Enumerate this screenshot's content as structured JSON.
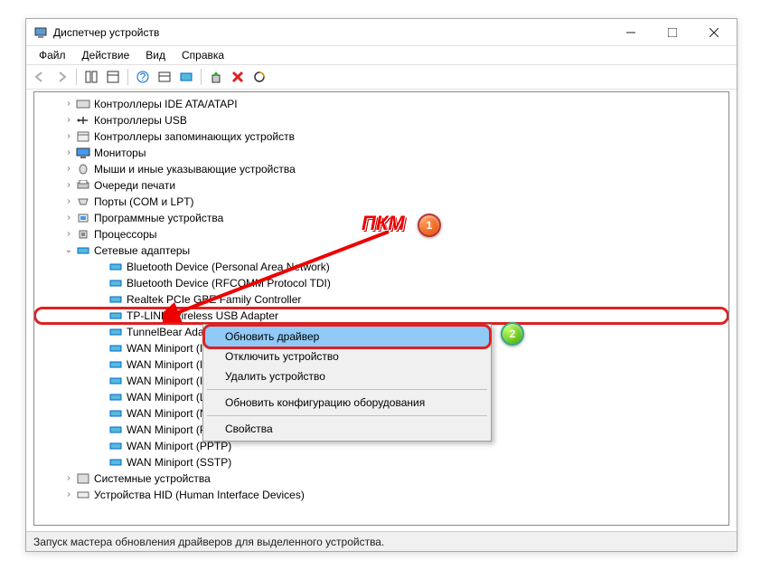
{
  "window": {
    "title": "Диспетчер устройств"
  },
  "menu": {
    "file": "Файл",
    "action": "Действие",
    "view": "Вид",
    "help": "Справка"
  },
  "categories": {
    "ide": "Контроллеры IDE ATA/ATAPI",
    "usb": "Контроллеры USB",
    "storage": "Контроллеры запоминающих устройств",
    "monitors": "Мониторы",
    "pointers": "Мыши и иные указывающие устройства",
    "printq": "Очереди печати",
    "ports": "Порты (COM и LPT)",
    "software": "Программные устройства",
    "cpu": "Процессоры",
    "net": "Сетевые адаптеры",
    "system": "Системные устройства",
    "hid": "Устройства HID (Human Interface Devices)"
  },
  "net_items": {
    "bt_pan": "Bluetooth Device (Personal Area Network)",
    "bt_rfcomm": "Bluetooth Device (RFCOMM Protocol TDI)",
    "realtek": "Realtek PCIe GBE Family Controller",
    "tplink": "TP-LINK Wireless USB Adapter",
    "tunnelbear": "TunnelBear Adapter V9",
    "wan_ike": "WAN Miniport (IKEv2)",
    "wan_ip": "WAN Miniport (IP)",
    "wan_ipv6": "WAN Miniport (IPv6)",
    "wan_l2tp": "WAN Miniport (L2TP)",
    "wan_netmon": "WAN Miniport (Network Monitor)",
    "wan_pppoe": "WAN Miniport (PPPOE)",
    "wan_pptp": "WAN Miniport (PPTP)",
    "wan_sstp": "WAN Miniport (SSTP)"
  },
  "context_menu": {
    "update": "Обновить драйвер",
    "disable": "Отключить устройство",
    "remove": "Удалить устройство",
    "rescan": "Обновить конфигурацию оборудования",
    "properties": "Свойства"
  },
  "annotations": {
    "pkm": "ПКМ",
    "marker1": "1",
    "marker2": "2"
  },
  "statusbar": "Запуск мастера обновления драйверов для выделенного устройства."
}
